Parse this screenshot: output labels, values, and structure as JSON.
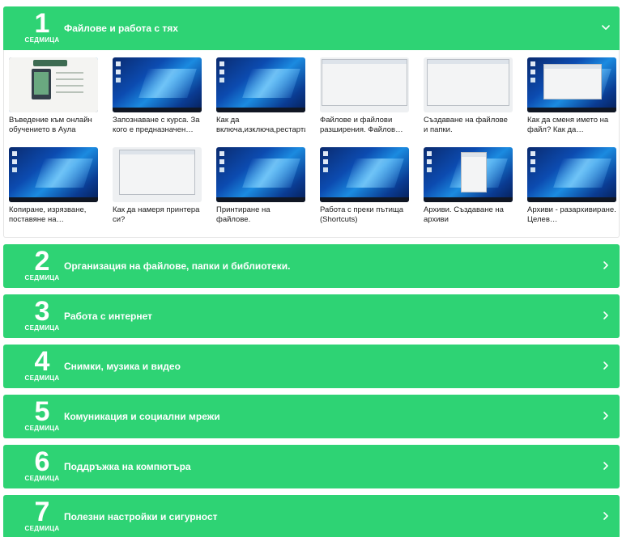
{
  "weeks": [
    {
      "number": "1",
      "label": "СЕДМИЦА",
      "title": "Файлове и работа с тях",
      "expanded": true,
      "lessons": [
        {
          "caption": "Въведение към онлайн обучението в Аула",
          "thumb": "intro"
        },
        {
          "caption": "Запознаване с курса. За кого е предназначен…",
          "thumb": "desktop"
        },
        {
          "caption": "Как да включа,изключа,рестартир…",
          "thumb": "desktop"
        },
        {
          "caption": "Файлове и файлови разширения. Файлов…",
          "thumb": "explorer"
        },
        {
          "caption": "Създаване на файлове и папки.",
          "thumb": "explorer"
        },
        {
          "caption": "Как да сменя името на файл? Как да преместя…",
          "thumb": "desktop-window"
        },
        {
          "caption": "Копиране, изрязване, поставяне на файлове.…",
          "thumb": "desktop"
        },
        {
          "caption": "Как да намеря принтера си?",
          "thumb": "settings"
        },
        {
          "caption": "Принтиране на файлове.",
          "thumb": "desktop"
        },
        {
          "caption": "Работа с преки пътища (Shortcuts)",
          "thumb": "desktop"
        },
        {
          "caption": "Архиви. Създаване на архиви",
          "thumb": "desktop-menu"
        },
        {
          "caption": "Архиви - разархивиране. Целев…",
          "thumb": "desktop"
        }
      ]
    },
    {
      "number": "2",
      "label": "СЕДМИЦА",
      "title": "Организация на файлове, папки и библиотеки.",
      "expanded": false
    },
    {
      "number": "3",
      "label": "СЕДМИЦА",
      "title": "Работа с интернет",
      "expanded": false
    },
    {
      "number": "4",
      "label": "СЕДМИЦА",
      "title": "Снимки, музика и видео",
      "expanded": false
    },
    {
      "number": "5",
      "label": "СЕДМИЦА",
      "title": "Комуникация и социални мрежи",
      "expanded": false
    },
    {
      "number": "6",
      "label": "СЕДМИЦА",
      "title": "Поддръжка на компютъра",
      "expanded": false
    },
    {
      "number": "7",
      "label": "СЕДМИЦА",
      "title": "Полезни настройки и сигурност",
      "expanded": false
    }
  ],
  "icons": {
    "expanded": "chevron-down-icon",
    "collapsed": "chevron-right-icon"
  },
  "colors": {
    "accent": "#2ed374",
    "text_on_accent": "#ffffff"
  }
}
